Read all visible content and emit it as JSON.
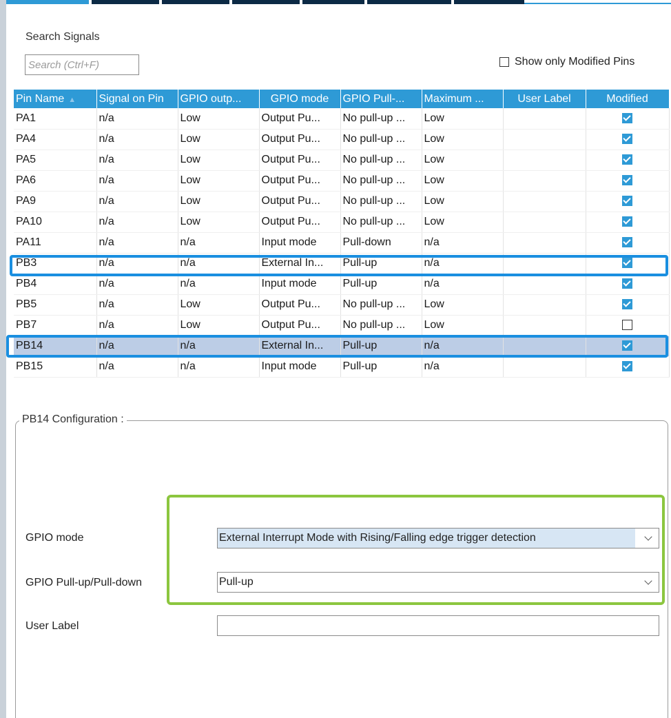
{
  "search": {
    "label": "Search Signals",
    "placeholder": "Search (Ctrl+F)"
  },
  "filter": {
    "label": "Show only Modified Pins",
    "checked": false
  },
  "columns": [
    "Pin Name",
    "Signal on Pin",
    "GPIO outp...",
    "GPIO mode",
    "GPIO Pull-...",
    "Maximum ...",
    "User Label",
    "Modified"
  ],
  "rows": [
    {
      "pin": "PA1",
      "signal": "n/a",
      "output": "Low",
      "mode": "Output Pu...",
      "pull": "No pull-up ...",
      "speed": "Low",
      "user_label": "",
      "modified": true
    },
    {
      "pin": "PA4",
      "signal": "n/a",
      "output": "Low",
      "mode": "Output Pu...",
      "pull": "No pull-up ...",
      "speed": "Low",
      "user_label": "",
      "modified": true
    },
    {
      "pin": "PA5",
      "signal": "n/a",
      "output": "Low",
      "mode": "Output Pu...",
      "pull": "No pull-up ...",
      "speed": "Low",
      "user_label": "",
      "modified": true
    },
    {
      "pin": "PA6",
      "signal": "n/a",
      "output": "Low",
      "mode": "Output Pu...",
      "pull": "No pull-up ...",
      "speed": "Low",
      "user_label": "",
      "modified": true
    },
    {
      "pin": "PA9",
      "signal": "n/a",
      "output": "Low",
      "mode": "Output Pu...",
      "pull": "No pull-up ...",
      "speed": "Low",
      "user_label": "",
      "modified": true
    },
    {
      "pin": "PA10",
      "signal": "n/a",
      "output": "Low",
      "mode": "Output Pu...",
      "pull": "No pull-up ...",
      "speed": "Low",
      "user_label": "",
      "modified": true
    },
    {
      "pin": "PA11",
      "signal": "n/a",
      "output": "n/a",
      "mode": "Input mode",
      "pull": "Pull-down",
      "speed": "n/a",
      "user_label": "",
      "modified": true
    },
    {
      "pin": "PB3",
      "signal": "n/a",
      "output": "n/a",
      "mode": "External In...",
      "pull": "Pull-up",
      "speed": "n/a",
      "user_label": "",
      "modified": true
    },
    {
      "pin": "PB4",
      "signal": "n/a",
      "output": "n/a",
      "mode": "Input mode",
      "pull": "Pull-up",
      "speed": "n/a",
      "user_label": "",
      "modified": true
    },
    {
      "pin": "PB5",
      "signal": "n/a",
      "output": "Low",
      "mode": "Output Pu...",
      "pull": "No pull-up ...",
      "speed": "Low",
      "user_label": "",
      "modified": true
    },
    {
      "pin": "PB7",
      "signal": "n/a",
      "output": "Low",
      "mode": "Output Pu...",
      "pull": "No pull-up ...",
      "speed": "Low",
      "user_label": "",
      "modified": false
    },
    {
      "pin": "PB14",
      "signal": "n/a",
      "output": "n/a",
      "mode": "External In...",
      "pull": "Pull-up",
      "speed": "n/a",
      "user_label": "",
      "modified": true,
      "selected": true
    },
    {
      "pin": "PB15",
      "signal": "n/a",
      "output": "n/a",
      "mode": "Input mode",
      "pull": "Pull-up",
      "speed": "n/a",
      "user_label": "",
      "modified": true
    }
  ],
  "config": {
    "title": "PB14 Configuration :",
    "gpio_mode_label": "GPIO mode",
    "gpio_mode_value": "External Interrupt Mode with Rising/Falling edge trigger detection",
    "pull_label": "GPIO Pull-up/Pull-down",
    "pull_value": "Pull-up",
    "user_label_label": "User Label",
    "user_label_value": ""
  },
  "colors": {
    "header": "#2e9ad6",
    "selected_row": "#bccde6",
    "row_highlight": "#1a8fe0",
    "form_highlight": "#8cc63f"
  },
  "icons": {
    "sort": "sort-up-icon",
    "dropdown": "chevron-down-icon",
    "checkbox": "checkbox-icon"
  }
}
